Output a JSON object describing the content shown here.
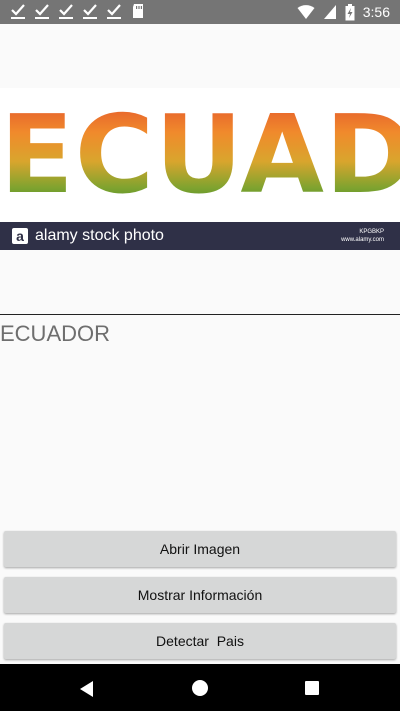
{
  "status_bar": {
    "time": "3:56",
    "left_icons": [
      "check-notification-icon",
      "check-notification-icon",
      "check-notification-icon",
      "check-notification-icon",
      "check-notification-icon",
      "sd-card-icon"
    ],
    "right_icons": [
      "wifi-icon",
      "cellular-signal-icon",
      "battery-charging-icon"
    ],
    "background": "#757575"
  },
  "image": {
    "word": "ECUADOR",
    "watermark": {
      "logo_letter": "a",
      "brand": "alamy stock photo",
      "code": "KPGBKP",
      "site": "www.alamy.com"
    }
  },
  "result": {
    "text": "ECUADOR"
  },
  "buttons": {
    "open_image": "Abrir Imagen",
    "show_info": "Mostrar Información",
    "detect_country": "Detectar  Pais"
  },
  "nav_bar": {
    "icons": [
      "back-icon",
      "home-icon",
      "recents-icon"
    ]
  }
}
